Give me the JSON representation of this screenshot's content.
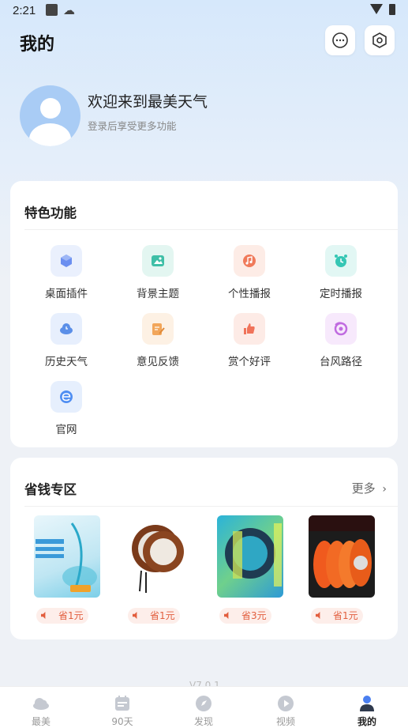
{
  "status": {
    "time": "2:21"
  },
  "header": {
    "title": "我的"
  },
  "profile": {
    "welcome": "欢迎来到最美天气",
    "hint": "登录后享受更多功能"
  },
  "features": {
    "title": "特色功能",
    "items": [
      {
        "label": "桌面插件",
        "icon": "cube-icon",
        "color": "#6b8ff0"
      },
      {
        "label": "背景主题",
        "icon": "image-icon",
        "color": "#3fbfa7"
      },
      {
        "label": "个性播报",
        "icon": "music-icon",
        "color": "#f07a5a"
      },
      {
        "label": "定时播报",
        "icon": "alarm-icon",
        "color": "#35c6b4"
      },
      {
        "label": "历史天气",
        "icon": "cloud-clock-icon",
        "color": "#5b8fe8"
      },
      {
        "label": "意见反馈",
        "icon": "edit-icon",
        "color": "#f2a65a"
      },
      {
        "label": "赏个好评",
        "icon": "thumbs-up-icon",
        "color": "#f0735a"
      },
      {
        "label": "台风路径",
        "icon": "typhoon-icon",
        "color": "#c06be0"
      },
      {
        "label": "官网",
        "icon": "website-icon",
        "color": "#4f8ef2"
      }
    ]
  },
  "savings": {
    "title": "省钱专区",
    "more": "更多",
    "products": [
      {
        "save": "省1元"
      },
      {
        "save": "省1元"
      },
      {
        "save": "省3元"
      },
      {
        "save": "省1元"
      }
    ]
  },
  "version": "V7.0.1",
  "tabs": [
    {
      "label": "最美",
      "icon": "weather-cloud-icon"
    },
    {
      "label": "90天",
      "icon": "calendar-icon"
    },
    {
      "label": "发现",
      "icon": "compass-icon"
    },
    {
      "label": "视频",
      "icon": "play-icon"
    },
    {
      "label": "我的",
      "icon": "user-icon",
      "active": true
    }
  ]
}
